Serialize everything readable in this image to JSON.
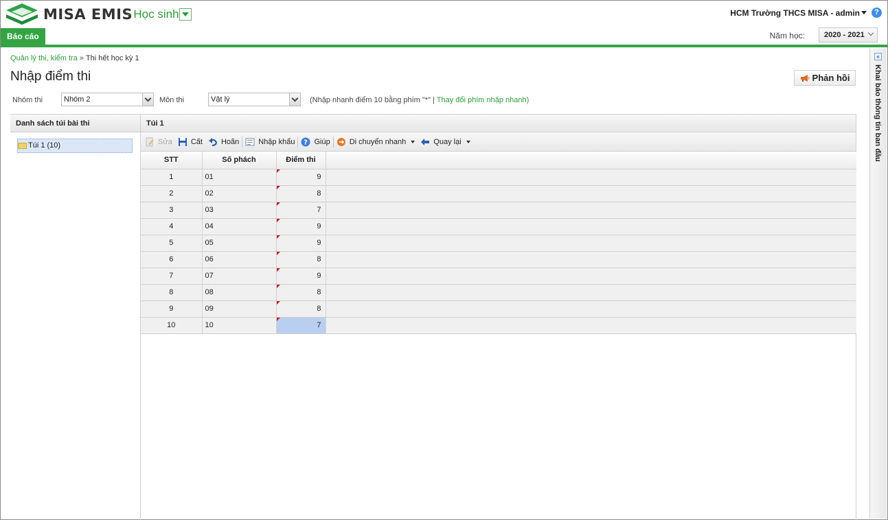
{
  "header": {
    "brand": "MISA EMIS",
    "module": "- Học sinh",
    "user": "HCM Trường THCS MISA - admin",
    "help_glyph": "?",
    "tab_report": "Báo cáo",
    "year_label": "Năm học:",
    "year_value": "2020 - 2021"
  },
  "breadcrumb": {
    "parent": "Quản lý thi, kiểm tra",
    "separator": "»",
    "current": "Thi hết học kỳ 1"
  },
  "page": {
    "title": "Nhập điểm thi",
    "feedback_label": "Phản hồi"
  },
  "filters": {
    "group_label": "Nhóm thi",
    "group_value": "Nhóm 2",
    "subject_label": "Môn thi",
    "subject_value": "Vật lý",
    "hint_text": "(Nhập nhanh điểm 10 bằng phím \"*\" |",
    "hint_link": "Thay đổi phím nhập nhanh)"
  },
  "left_panel": {
    "header": "Danh sách túi bài thi",
    "items": [
      {
        "label": "Túi 1 (10)"
      }
    ]
  },
  "right_panel": {
    "header": "Túi 1"
  },
  "toolbar": {
    "edit": "Sửa",
    "save": "Cất",
    "undo": "Hoãn",
    "import": "Nhập khẩu",
    "help": "Giúp",
    "quick_move": "Di chuyển nhanh",
    "back": "Quay lại"
  },
  "table": {
    "columns": [
      "STT",
      "Số phách",
      "Điểm thi"
    ],
    "rows": [
      {
        "stt": "1",
        "code": "01",
        "score": "9"
      },
      {
        "stt": "2",
        "code": "02",
        "score": "8"
      },
      {
        "stt": "3",
        "code": "03",
        "score": "7"
      },
      {
        "stt": "4",
        "code": "04",
        "score": "9"
      },
      {
        "stt": "5",
        "code": "05",
        "score": "9"
      },
      {
        "stt": "6",
        "code": "06",
        "score": "8"
      },
      {
        "stt": "7",
        "code": "07",
        "score": "9"
      },
      {
        "stt": "8",
        "code": "08",
        "score": "8"
      },
      {
        "stt": "9",
        "code": "09",
        "score": "8"
      },
      {
        "stt": "10",
        "code": "10",
        "score": "7"
      }
    ],
    "selected_row": 9
  },
  "side_panel": {
    "title": "Khai báo thông tin ban đầu",
    "collapse_glyph": "«"
  },
  "colors": {
    "brand_green": "#34a443",
    "link_green": "#2e9a3a",
    "selected_cell": "#b9cff0",
    "dirty_marker": "#c21a1a"
  }
}
